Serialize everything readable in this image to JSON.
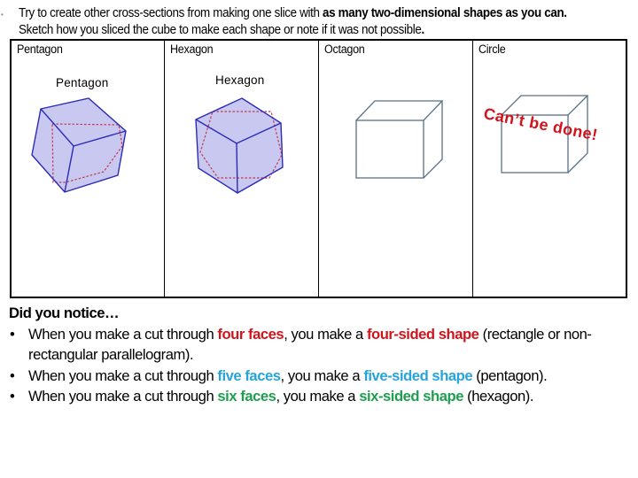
{
  "intro": {
    "line1_plain": "Try to create other cross-sections from making one slice with ",
    "line1_bold": "as many two-dimensional shapes as you can.",
    "line2_plain": "Sketch how you sliced the cube to make each shape or note if it was not possible",
    "line2_end": "."
  },
  "table": {
    "columns": [
      {
        "header": "Pentagon",
        "image_label": "Pentagon",
        "diagram": "cube-with-pentagon-cross-section"
      },
      {
        "header": "Hexagon",
        "image_label": "Hexagon",
        "diagram": "cube-with-hexagon-cross-section"
      },
      {
        "header": "Octagon",
        "image_label": "",
        "diagram": "empty-cube"
      },
      {
        "header": "Circle",
        "image_label": "",
        "diagram": "empty-cube",
        "annotation": "Can’t be done!"
      }
    ]
  },
  "notice": {
    "title": "Did you notice…",
    "items": [
      {
        "p1": "When you make a cut through ",
        "h1": "four faces",
        "p2": ", you make a ",
        "h2": "four-sided shape",
        "p3": " (rectangle or non-rectangular parallelogram).",
        "color": "#d0141c"
      },
      {
        "p1": "When you make a cut through ",
        "h1": "five faces",
        "p2": ", you make a ",
        "h2": "five-sided shape",
        "p3": " (pentagon).",
        "color": "#27a4d9"
      },
      {
        "p1": "When you make a cut through ",
        "h1": "six faces",
        "p2": ", you make a ",
        "h2": "six-sided shape",
        "p3": " (hexagon).",
        "color": "#1f9e4f"
      }
    ]
  },
  "colors": {
    "cube_fill": "#c8c8f0",
    "cube_edge": "#2b2bb5",
    "slice_dash": "#c0394f",
    "plain_cube_edge": "#5a7185",
    "annotation": "#d3121b"
  }
}
